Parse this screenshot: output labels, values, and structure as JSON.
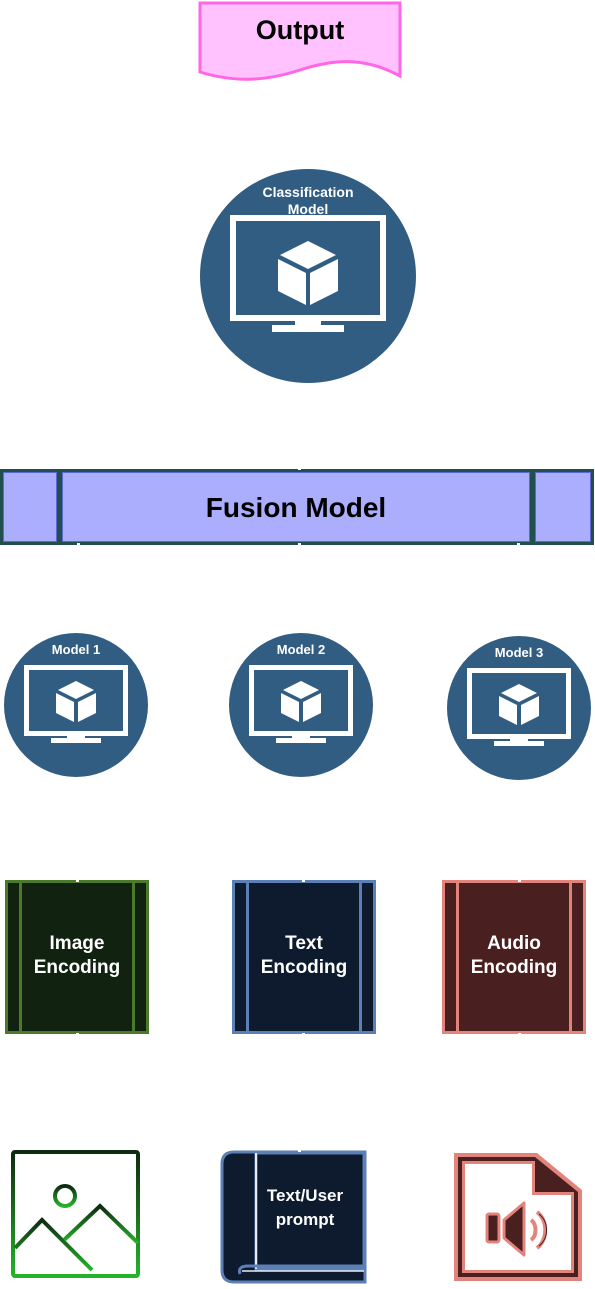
{
  "diagram": {
    "output": {
      "label": "Output",
      "fill": "#ffc2ff",
      "stroke": "#ff66e6"
    },
    "classification_model": {
      "title_line1": "Classification",
      "title_line2": "Model",
      "fill": "#325d82"
    },
    "fusion_model": {
      "label": "Fusion Model",
      "fill": "#aaaefc",
      "stroke": "#214f4d"
    },
    "models": [
      {
        "label": "Model 1"
      },
      {
        "label": "Model 2"
      },
      {
        "label": "Model 3"
      }
    ],
    "encodings": [
      {
        "line1": "Image",
        "line2": "Encoding",
        "fill": "#112211",
        "stroke": "#4a7a2a"
      },
      {
        "line1": "Text",
        "line2": "Encoding",
        "fill": "#0e1b2e",
        "stroke": "#5c7fb6"
      },
      {
        "line1": "Audio",
        "line2": "Encoding",
        "fill": "#4a1f1f",
        "stroke": "#e3847c"
      }
    ],
    "inputs": [
      {
        "name": "image",
        "icon": "image-icon"
      },
      {
        "name": "text",
        "line1": "Text/User",
        "line2": "prompt",
        "icon": "book-icon"
      },
      {
        "name": "audio",
        "icon": "audio-file-icon"
      }
    ]
  }
}
